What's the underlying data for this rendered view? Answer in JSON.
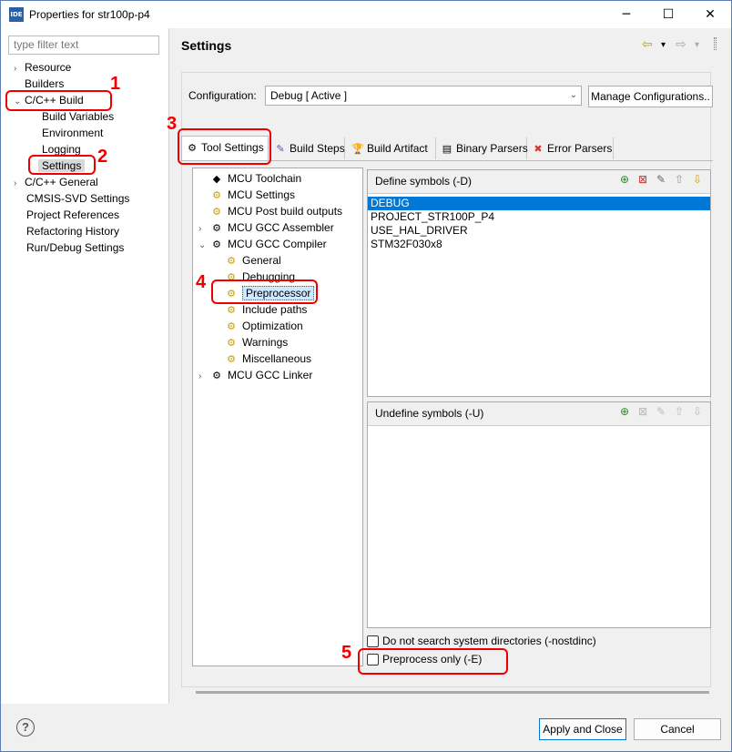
{
  "window": {
    "title": "Properties for str100p-p4",
    "icon_label": "IDE",
    "controls": {
      "minimize": "─",
      "maximize": "☐",
      "close": "✕"
    }
  },
  "left": {
    "filter_placeholder": "type filter text",
    "tree": [
      {
        "label": "Resource",
        "chevron": "›"
      },
      {
        "label": "Builders",
        "chevron": ""
      },
      {
        "label": "C/C++ Build",
        "chevron": "⌄"
      },
      {
        "label": "Build Variables"
      },
      {
        "label": "Environment"
      },
      {
        "label": "Logging"
      },
      {
        "label": "Settings"
      },
      {
        "label": "C/C++ General",
        "chevron": "›"
      },
      {
        "label": "CMSIS-SVD Settings"
      },
      {
        "label": "Project References"
      },
      {
        "label": "Refactoring History"
      },
      {
        "label": "Run/Debug Settings"
      }
    ]
  },
  "header": {
    "title": "Settings",
    "back_icon": "⇦",
    "forward_icon": "⇨",
    "dropdown_icon": "▾"
  },
  "config": {
    "label": "Configuration:",
    "value": "Debug  [ Active ]",
    "manage_button": "Manage Configurations.."
  },
  "tabs": [
    {
      "label": "Tool Settings",
      "icon": "⚙"
    },
    {
      "label": "Build Steps",
      "icon": "✎"
    },
    {
      "label": "Build Artifact",
      "icon": "🏆"
    },
    {
      "label": "Binary Parsers",
      "icon": "▤"
    },
    {
      "label": "Error Parsers",
      "icon": "✖"
    }
  ],
  "tooltree": [
    {
      "label": "MCU Toolchain",
      "icon": "◆"
    },
    {
      "label": "MCU Settings",
      "icon": "⚙"
    },
    {
      "label": "MCU Post build outputs",
      "icon": "⚙"
    },
    {
      "label": "MCU GCC Assembler",
      "icon": "⚙",
      "chevron": "›"
    },
    {
      "label": "MCU GCC Compiler",
      "icon": "⚙",
      "chevron": "⌄"
    },
    {
      "label": "General",
      "icon": "⚙"
    },
    {
      "label": "Debugging",
      "icon": "⚙"
    },
    {
      "label": "Preprocessor",
      "icon": "⚙"
    },
    {
      "label": "Include paths",
      "icon": "⚙"
    },
    {
      "label": "Optimization",
      "icon": "⚙"
    },
    {
      "label": "Warnings",
      "icon": "⚙"
    },
    {
      "label": "Miscellaneous",
      "icon": "⚙"
    },
    {
      "label": "MCU GCC Linker",
      "icon": "⚙",
      "chevron": "›"
    }
  ],
  "define": {
    "title": "Define symbols (-D)",
    "symbols": [
      "DEBUG",
      "PROJECT_STR100P_P4",
      "USE_HAL_DRIVER",
      "STM32F030x8"
    ]
  },
  "undefine": {
    "title": "Undefine symbols (-U)"
  },
  "toolbar_icons": [
    "add-icon",
    "delete-icon",
    "edit-icon",
    "move-up-icon",
    "move-down-icon"
  ],
  "checkboxes": {
    "nostdinc": "Do not search system directories (-nostdinc)",
    "preprocess": "Preprocess only (-E)"
  },
  "annotations": [
    "1",
    "2",
    "3",
    "4",
    "5"
  ],
  "buttons": {
    "apply": "Apply and Close",
    "cancel": "Cancel",
    "help": "?"
  },
  "colors": {
    "accent": "#0078d7",
    "annotation": "#ee0000"
  }
}
